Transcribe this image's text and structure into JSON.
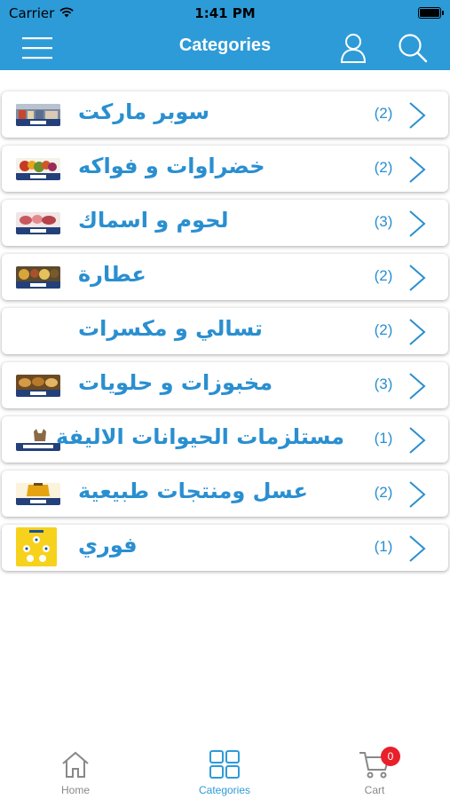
{
  "status": {
    "carrier": "Carrier",
    "time": "1:41 PM"
  },
  "header": {
    "title": "Categories"
  },
  "categories": [
    {
      "name": "سوبر ماركت",
      "count": "(2)"
    },
    {
      "name": "خضراوات و فواكه",
      "count": "(2)"
    },
    {
      "name": "لحوم و اسماك",
      "count": "(3)"
    },
    {
      "name": "عطارة",
      "count": "(2)"
    },
    {
      "name": "تسالي و مكسرات",
      "count": "(2)"
    },
    {
      "name": "مخبوزات و حلويات",
      "count": "(3)"
    },
    {
      "name": "مستلزمات الحيوانات الاليفة",
      "count": "(1)"
    },
    {
      "name": "عسل ومنتجات طبيعية",
      "count": "(2)"
    },
    {
      "name": "فوري",
      "count": "(1)"
    }
  ],
  "tabs": {
    "home": "Home",
    "categories": "Categories",
    "cart": "Cart",
    "cart_badge": "0"
  },
  "colors": {
    "accent": "#2d9bd8",
    "text_blue": "#2a8fd0",
    "tab_inactive": "#888888",
    "badge": "#e8202a"
  }
}
